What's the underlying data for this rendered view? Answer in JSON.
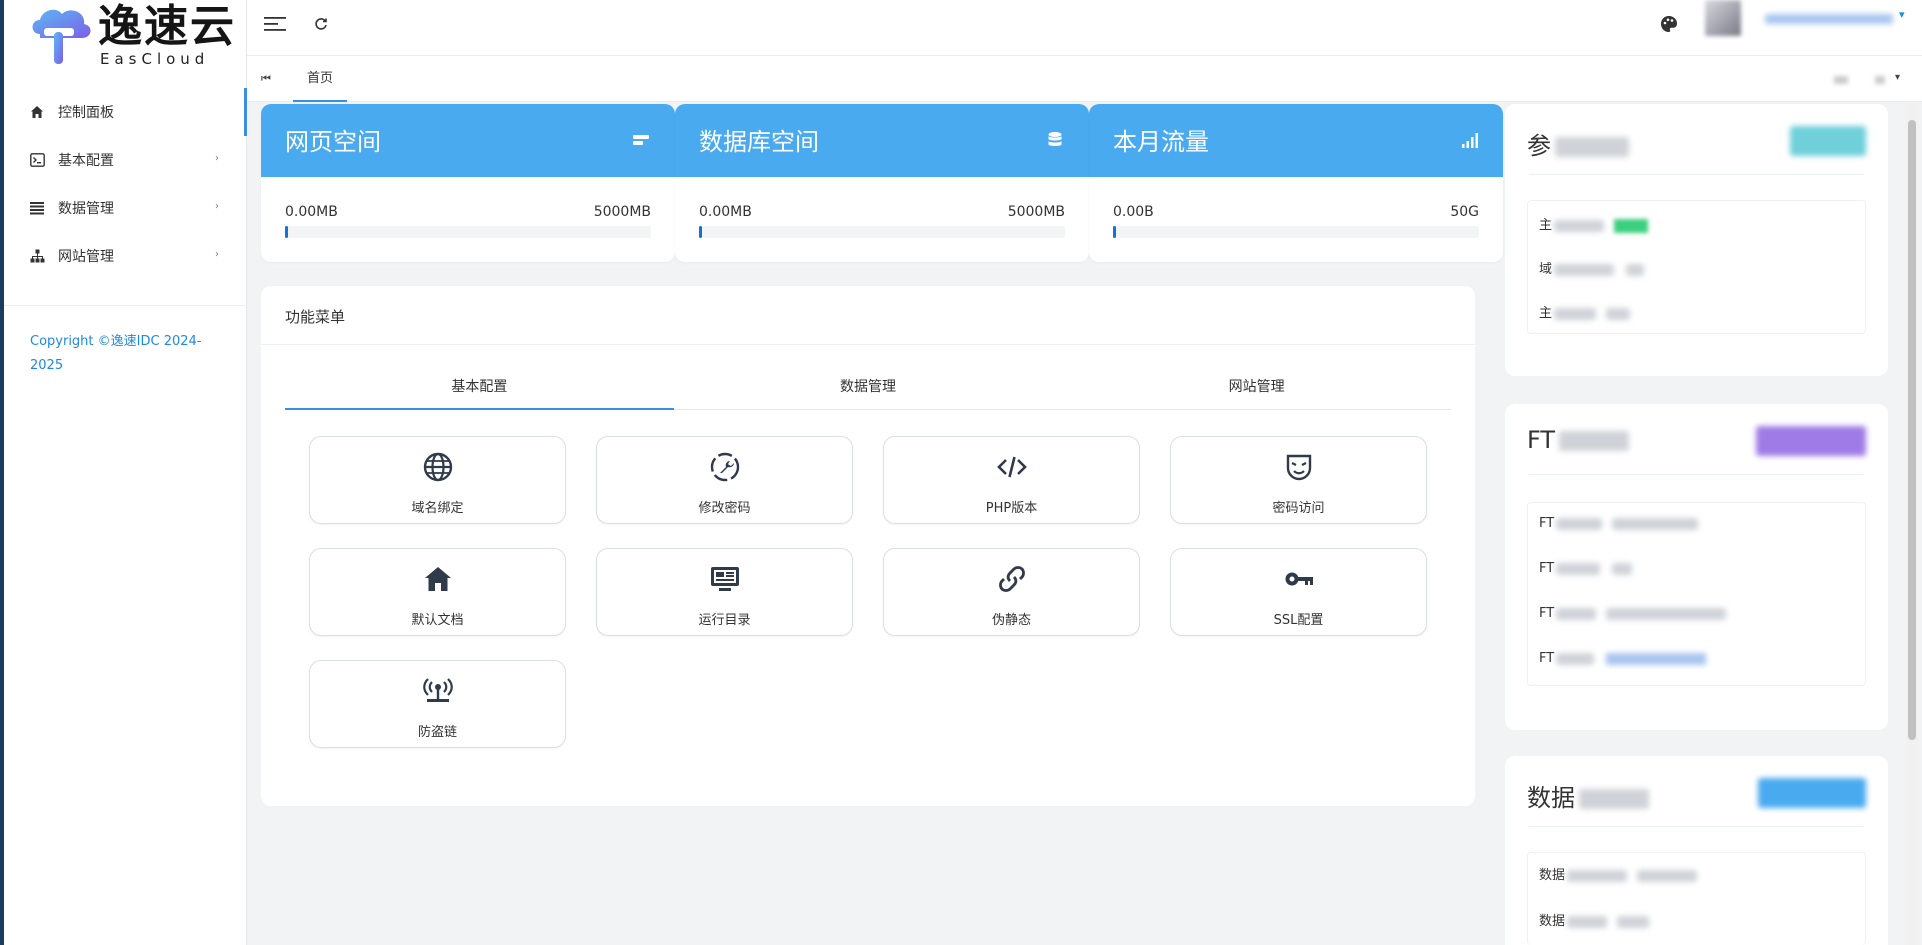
{
  "brand": {
    "name": "逸速云",
    "sub": "EasCloud",
    "colors": {
      "accent": "#4aaaf0",
      "link": "#1e88e5"
    }
  },
  "sidebar": {
    "items": [
      {
        "label": "控制面板",
        "icon": "home-icon",
        "active": true
      },
      {
        "label": "基本配置",
        "icon": "terminal-icon",
        "has_children": true
      },
      {
        "label": "数据管理",
        "icon": "list-icon",
        "has_children": true
      },
      {
        "label": "网站管理",
        "icon": "sitemap-icon",
        "has_children": true
      }
    ],
    "chevron": "›",
    "copyright": "Copyright ©逸速IDC 2024-2025"
  },
  "header": {
    "menu_icon": "menu-icon",
    "refresh_icon": "refresh-icon",
    "theme_icon": "palette-icon",
    "user_caret": "▾"
  },
  "tabs": {
    "first_icon": "⏮",
    "home": "首页",
    "right_caret": "▾"
  },
  "stats": [
    {
      "title": "网页空间",
      "icon": "server-icon",
      "used": "0.00MB",
      "total": "5000MB",
      "progress": 0.005
    },
    {
      "title": "数据库空间",
      "icon": "database-icon",
      "used": "0.00MB",
      "total": "5000MB",
      "progress": 0.005
    },
    {
      "title": "本月流量",
      "icon": "signal-icon",
      "used": "0.00B",
      "total": "50G",
      "progress": 0.005
    }
  ],
  "menu": {
    "title": "功能菜单",
    "tabs": [
      "基本配置",
      "数据管理",
      "网站管理"
    ],
    "active_tab": 0,
    "tiles": [
      {
        "label": "域名绑定",
        "icon": "globe-icon"
      },
      {
        "label": "修改密码",
        "icon": "wrench-icon"
      },
      {
        "label": "PHP版本",
        "icon": "code-icon"
      },
      {
        "label": "密码访问",
        "icon": "mask-icon"
      },
      {
        "label": "默认文档",
        "icon": "house-icon"
      },
      {
        "label": "运行目录",
        "icon": "monitor-icon"
      },
      {
        "label": "伪静态",
        "icon": "link-icon"
      },
      {
        "label": "SSL配置",
        "icon": "key-icon"
      },
      {
        "label": "防盗链",
        "icon": "antenna-icon"
      }
    ]
  },
  "right": {
    "cards": [
      {
        "title": "参",
        "badge_color": "#6fd0da",
        "rows": [
          "主",
          "域",
          "主"
        ],
        "row_badge_color": "#3ccf7f"
      },
      {
        "title": "FT",
        "badge_color": "#9e7be6",
        "rows": [
          "FT",
          "FT",
          "FT",
          "FT"
        ]
      },
      {
        "title": "数据",
        "badge_color": "#4aaaf0",
        "rows": [
          "数据",
          "数据"
        ]
      }
    ]
  }
}
